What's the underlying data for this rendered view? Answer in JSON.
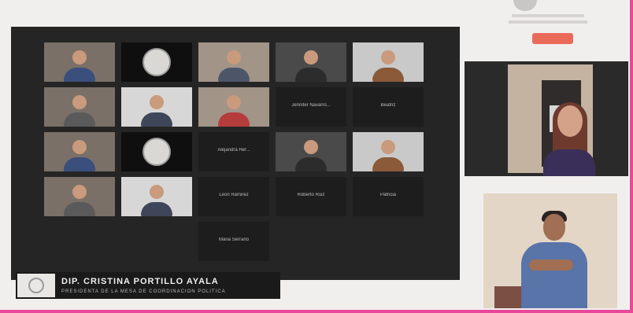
{
  "colors": {
    "background": "#f1efee",
    "gallery_bg": "#252525",
    "accent_pink": "#e8479a",
    "tag_red": "#ea6a5a"
  },
  "page": {
    "title_text": ""
  },
  "gallery": {
    "participants": [
      {
        "type": "video",
        "name": ""
      },
      {
        "type": "logo",
        "name": ""
      },
      {
        "type": "video",
        "name": ""
      },
      {
        "type": "video",
        "name": ""
      },
      {
        "type": "video",
        "name": ""
      },
      {
        "type": "video",
        "name": ""
      },
      {
        "type": "video",
        "name": ""
      },
      {
        "type": "video",
        "name": ""
      },
      {
        "type": "name",
        "name": "Jennifer Navarro..."
      },
      {
        "type": "name",
        "name": "Beatriz"
      },
      {
        "type": "video",
        "name": ""
      },
      {
        "type": "logo",
        "name": ""
      },
      {
        "type": "name",
        "name": "Alejandra Her..."
      },
      {
        "type": "video",
        "name": ""
      },
      {
        "type": "video",
        "name": ""
      },
      {
        "type": "video",
        "name": ""
      },
      {
        "type": "video",
        "name": ""
      },
      {
        "type": "name",
        "name": "Leon Ramirez"
      },
      {
        "type": "name",
        "name": "Roberto Ruiz"
      },
      {
        "type": "name",
        "name": "Patricia"
      },
      {
        "type": "name",
        "name": "Maria Serrano"
      }
    ]
  },
  "lower_third": {
    "name": "DIP. CRISTINA PORTILLO AYALA",
    "role": "PRESIDENTA DE LA MESA DE COORDINACION POLITICA"
  },
  "icons": [
    "camera-tile-icon",
    "seal-logo-icon"
  ]
}
